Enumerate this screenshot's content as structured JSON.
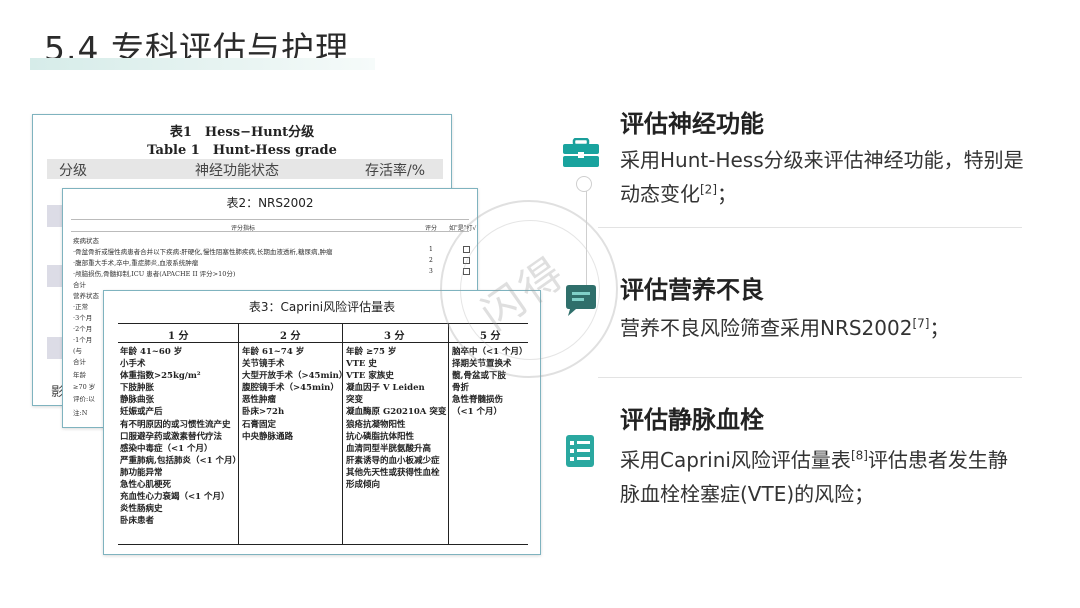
{
  "page_title": "5.4 专科评估与护理",
  "sections": [
    {
      "title": "评估神经功能",
      "text_a": "采用Hunt-Hess分级来评估神经功能，特别是动态变化",
      "ref": "[2]",
      "text_b": "；",
      "icon": "briefcase-icon"
    },
    {
      "title": "评估营养不良",
      "text_a": "营养不良风险筛查采用NRS2002",
      "ref": "[7]",
      "text_b": "；",
      "icon": "chat-icon"
    },
    {
      "title": "评估静脉血栓",
      "text_a": "采用Caprini风险评估量表",
      "ref": "[8]",
      "text_b": "评估患者发生静脉血栓栓塞症(VTE)的风险；",
      "icon": "list-icon"
    }
  ],
  "table1": {
    "title": "表1　Hess−Hunt分级",
    "subtitle": "Table 1　Hunt-Hess grade",
    "headers": [
      "分级",
      "神经功能状态",
      "存活率/%"
    ],
    "side_text": [
      "影",
      "年龄",
      "≥70 岁",
      "评价:以",
      "注:N"
    ]
  },
  "table2": {
    "title": "表2：NRS2002",
    "headers": [
      "评分指标",
      "评分",
      "如\"是\"打√"
    ],
    "rows": [
      {
        "label": "疾病状态",
        "score": ""
      },
      {
        "label": "·骨盆骨折或慢性病患者合并以下疾病:肝硬化,慢性阻塞性肺疾病,长期血液透析,糖尿病,肿瘤",
        "score": "1"
      },
      {
        "label": "·腹部重大手术,卒中,重症肺炎,血液系统肿瘤",
        "score": "2"
      },
      {
        "label": "·颅脑损伤,骨髓抑制,ICU 患者(APACHE II 评分>10分)",
        "score": "3"
      },
      {
        "label": "合计",
        "score": ""
      },
      {
        "label": "营养状态",
        "score": ""
      },
      {
        "label": "·正常",
        "score": ""
      },
      {
        "label": "·3个月",
        "score": ""
      },
      {
        "label": "·2个月",
        "score": ""
      },
      {
        "label": "·1个月",
        "score": ""
      },
      {
        "label": "(与",
        "score": ""
      },
      {
        "label": "合计",
        "score": ""
      }
    ]
  },
  "table3": {
    "title": "表3：Caprini风险评估量表",
    "headers": [
      "1 分",
      "2 分",
      "3 分",
      "5 分"
    ],
    "col1": [
      "年龄 41~60 岁",
      "小手术",
      "体重指数>25kg/m²",
      "下肢肿胀",
      "静脉曲张",
      "妊娠或产后",
      "有不明原因的或习惯性流产史",
      "口服避孕药或激素替代疗法",
      "感染中毒症（<1 个月）",
      "严重肺病,包括肺炎（<1 个月）",
      "肺功能异常",
      "急性心肌梗死",
      "充血性心力衰竭（<1 个月）",
      "炎性肠病史",
      "卧床患者"
    ],
    "col2": [
      "年龄 61~74 岁",
      "关节镜手术",
      "大型开放手术（>45min）",
      "腹腔镜手术（>45min）",
      "恶性肿瘤",
      "卧床>72h",
      "石膏固定",
      "中央静脉通路"
    ],
    "col3": [
      "年龄 ≥75 岁",
      "VTE 史",
      "VTE 家族史",
      "凝血因子 V Leiden",
      "突变",
      "凝血酶原 G20210A 突变",
      "狼疮抗凝物阳性",
      "抗心磷脂抗体阳性",
      "血清同型半胱氨酸升高",
      "肝素诱导的血小板减少症",
      "其他先天性或获得性血栓",
      "形成倾向"
    ],
    "col4": [
      "脑卒中（<1 个月）",
      "择期关节置换术",
      "髋,骨盆或下肢",
      "骨折",
      "急性脊髓损伤",
      "（<1 个月）"
    ]
  },
  "watermark": "闪得"
}
